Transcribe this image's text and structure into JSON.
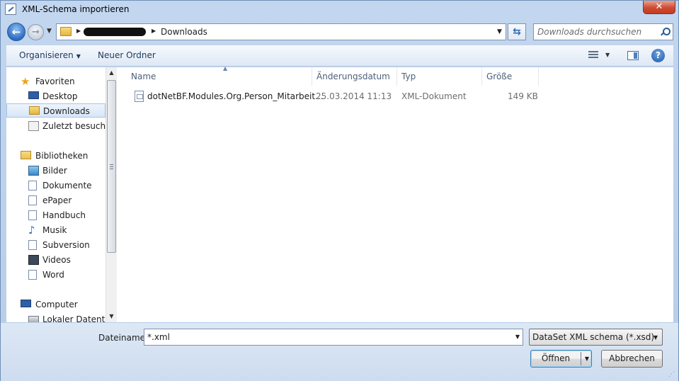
{
  "window": {
    "title": "XML-Schema importieren",
    "close_glyph": "✕"
  },
  "navigation": {
    "back_glyph": "←",
    "forward_glyph": "→",
    "address_crumb": "Downloads",
    "search_placeholder": "Downloads durchsuchen"
  },
  "commandbar": {
    "organize_label": "Organisieren",
    "new_folder_label": "Neuer Ordner",
    "help_glyph": "?"
  },
  "sidebar": {
    "items": [
      {
        "label": "Favoriten",
        "icon": "star-icon"
      },
      {
        "label": "Desktop",
        "icon": "desktop-icon"
      },
      {
        "label": "Downloads",
        "icon": "downloads-folder-icon",
        "selected": true
      },
      {
        "label": "Zuletzt besucht",
        "icon": "recent-places-icon"
      },
      {
        "label": "Bibliotheken",
        "icon": "libraries-icon"
      },
      {
        "label": "Bilder",
        "icon": "pictures-icon"
      },
      {
        "label": "Dokumente",
        "icon": "documents-icon"
      },
      {
        "label": "ePaper",
        "icon": "library-doc-icon"
      },
      {
        "label": "Handbuch",
        "icon": "library-doc-icon"
      },
      {
        "label": "Musik",
        "icon": "music-icon"
      },
      {
        "label": "Subversion",
        "icon": "library-doc-icon"
      },
      {
        "label": "Videos",
        "icon": "videos-icon"
      },
      {
        "label": "Word",
        "icon": "library-doc-icon"
      },
      {
        "label": "Computer",
        "icon": "computer-icon"
      },
      {
        "label": "Lokaler Datenträ",
        "icon": "drive-icon"
      }
    ]
  },
  "file_list": {
    "columns": [
      "Name",
      "Änderungsdatum",
      "Typ",
      "Größe"
    ],
    "rows": [
      {
        "name": "dotNetBF.Modules.Org.Person_Mitarbeit...",
        "date": "25.03.2014 11:13",
        "type": "XML-Dokument",
        "size": "149 KB"
      }
    ]
  },
  "footer": {
    "filename_label": "Dateiname:",
    "filename_value": "*.xml",
    "filetype_value": "DataSet XML schema (*.xsd)",
    "open_label": "Öffnen",
    "cancel_label": "Abbrechen"
  },
  "colors": {
    "accent": "#2b6cc4",
    "selection": "#d8e6f7",
    "titlebar": "#c2d6ef"
  }
}
